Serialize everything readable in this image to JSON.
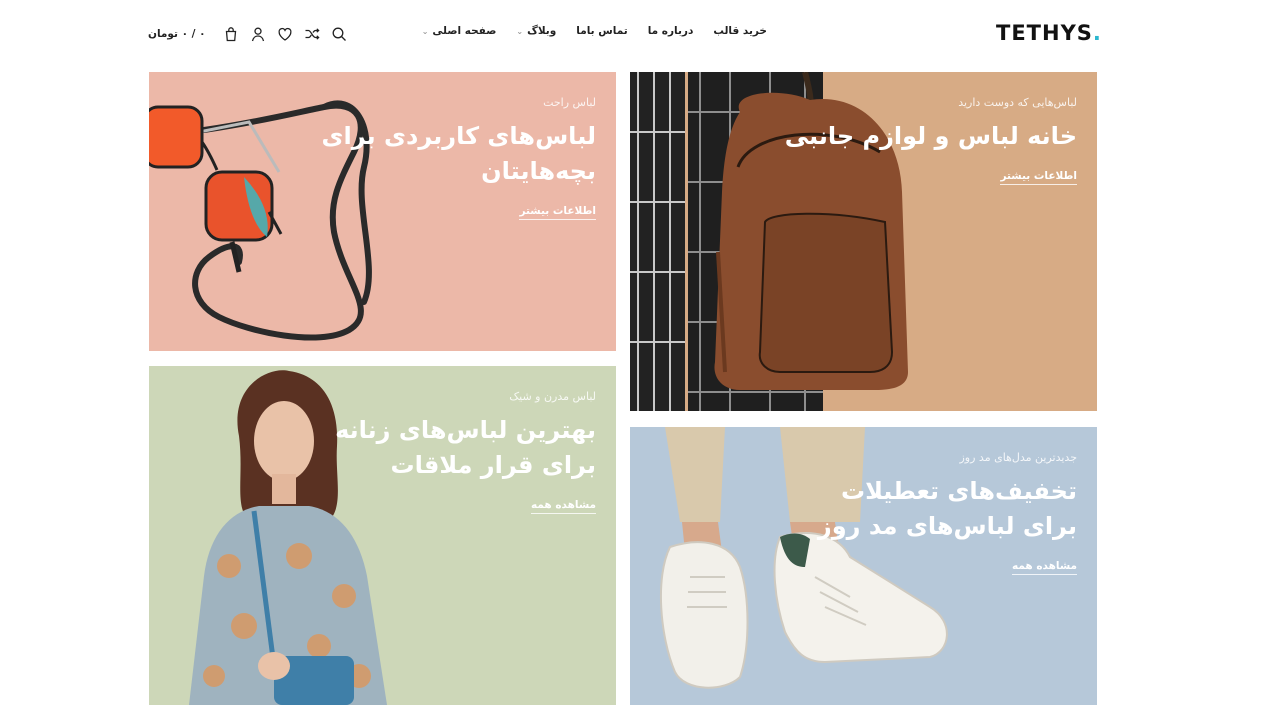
{
  "header": {
    "logo": "TETHYS",
    "logo_dot": ".",
    "nav": [
      {
        "label": "صفحه اصلی",
        "has_dropdown": true
      },
      {
        "label": "وبلاگ",
        "has_dropdown": true
      },
      {
        "label": "تماس باما",
        "has_dropdown": false
      },
      {
        "label": "درباره ما",
        "has_dropdown": false
      },
      {
        "label": "خرید قالب",
        "has_dropdown": false
      }
    ],
    "cart_total": "۰ / ۰ تومان",
    "icons": [
      "search-icon",
      "compare-icon",
      "wishlist-icon",
      "account-icon",
      "cart-icon"
    ]
  },
  "banners": [
    {
      "id": "kids",
      "subtitle": "لباس راحت",
      "title_line1": "لباس‌های کاربردی برای",
      "title_line2": "بچه‌هایتان",
      "link": "اطلاعات بیشتر",
      "bg": "#ecb8a8"
    },
    {
      "id": "accessories",
      "subtitle": "لباس‌هایی که دوست دارید",
      "title_line1": "خانه لباس و لوازم جانبی",
      "title_line2": "",
      "link": "اطلاعات بیشتر",
      "bg": "#d7ab85"
    },
    {
      "id": "women",
      "subtitle": "لباس مدرن و شیک",
      "title_line1": "بهترین لباس‌های زنانه",
      "title_line2": "برای قرار ملاقات",
      "link": "مشاهده همه",
      "bg": "#cdd7b8"
    },
    {
      "id": "sale",
      "subtitle": "جدیدترین مدل‌های مد روز",
      "title_line1": "تخفیف‌های تعطیلات",
      "title_line2": "برای لباس‌های مد روز",
      "link": "مشاهده همه",
      "bg": "#b6c8d9"
    }
  ],
  "colors": {
    "accent": "#2bb7cf",
    "text": "#222222"
  }
}
